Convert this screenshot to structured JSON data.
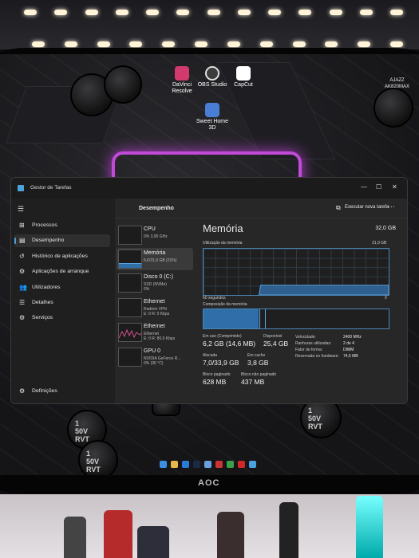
{
  "desktop": {
    "icons": [
      {
        "label": "DaVinci\nResolve",
        "color": "#d23a6e"
      },
      {
        "label": "OBS Studio",
        "color": "#3c3c3c"
      },
      {
        "label": "CapCut",
        "color": "#ffffff"
      },
      {
        "label": "Sweet Home\n3D",
        "color": "#4a7ed4"
      }
    ],
    "brand": "AJAZZ\nAK820MAX",
    "capacitor_label": "1\n50V\nRVT",
    "monitor_brand": "AOC"
  },
  "window": {
    "title": "Gestor de Tarefas"
  },
  "nav": {
    "items": [
      {
        "icon": "⊞",
        "label": "Processos"
      },
      {
        "icon": "▤",
        "label": "Desempenho"
      },
      {
        "icon": "↺",
        "label": "Histórico de aplicações"
      },
      {
        "icon": "⚙",
        "label": "Aplicações de arranque"
      },
      {
        "icon": "👥",
        "label": "Utilizadores"
      },
      {
        "icon": "☰",
        "label": "Detalhes"
      },
      {
        "icon": "⚙",
        "label": "Serviços"
      }
    ],
    "settings": "Definições"
  },
  "header": {
    "title": "Desempenho",
    "run_task": "Executar nova tarefa",
    "more": "···"
  },
  "devices": [
    {
      "name": "CPU",
      "sub": "0% 3,95 GHz"
    },
    {
      "name": "Memória",
      "sub": "6,6/31,9 GB (21%)"
    },
    {
      "name": "Disco 0 (C:)",
      "sub": "SSD (NVMe)\n0%"
    },
    {
      "name": "Ethernet",
      "sub": "Radmin VPN\nE: 0 R: 0 Kbps"
    },
    {
      "name": "Ethernet",
      "sub": "Ethernet\nE: 0 R: 80,0 Kbps"
    },
    {
      "name": "GPU 0",
      "sub": "NVIDIA GeForce R...\n0% (36 °C)"
    }
  ],
  "memory": {
    "title": "Memória",
    "total": "32,0 GB",
    "usage_label": "Utilização da memória",
    "usage_max": "31,9 GB",
    "time_label": "60 segundos",
    "time_end": "0",
    "composition_label": "Composição da memória",
    "usage_fraction": 0.21,
    "stats": {
      "in_use_label": "Em uso (Comprimido)",
      "in_use": "6,2 GB (14,6 MB)",
      "available_label": "Disponível",
      "available": "25,4 GB",
      "committed_label": "Alocada",
      "committed": "7,0/33,9 GB",
      "cached_label": "Em cache",
      "cached": "3,8 GB",
      "paged_label": "Bloco paginado",
      "paged": "628 MB",
      "nonpaged_label": "Bloco não paginado",
      "nonpaged": "437 MB"
    },
    "hardware": [
      {
        "k": "Velocidade:",
        "v": "2400 MHz"
      },
      {
        "k": "Ranhuras utilizadas:",
        "v": "2 de 4"
      },
      {
        "k": "Fator de forma:",
        "v": "DIMM"
      },
      {
        "k": "Reservada no hardware:",
        "v": "74,5 MB"
      }
    ]
  },
  "colors": {
    "accent": "#4ea3d8",
    "memory_fill": "#2f6ea8",
    "neon": "#c14ad8"
  }
}
